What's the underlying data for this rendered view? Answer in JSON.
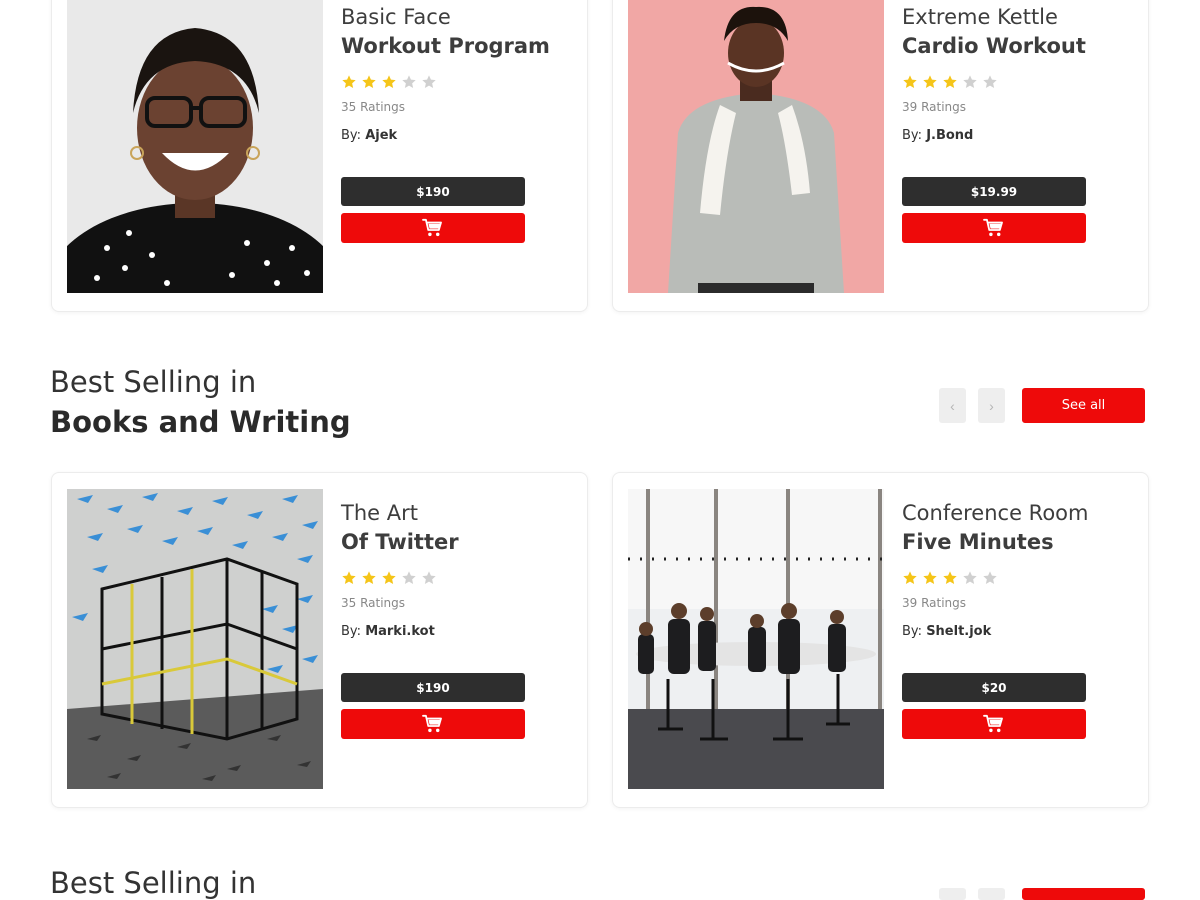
{
  "colors": {
    "accent": "#ee0a0a",
    "price_bg": "#2e2e2e",
    "star_filled": "#f5c518",
    "star_empty": "#d0d0d0"
  },
  "top_products": [
    {
      "title_line1": "Basic Face",
      "title_line2": "Workout Program",
      "rating": 3,
      "max_rating": 5,
      "ratings_count": "35 Ratings",
      "by_label": "By:",
      "author": "Ajek",
      "price": "$190",
      "image": "woman-smiling-portrait",
      "cart_icon": "cart-icon"
    },
    {
      "title_line1": "Extreme Kettle",
      "title_line2": "Cardio Workout",
      "rating": 3,
      "max_rating": 5,
      "ratings_count": "39 Ratings",
      "by_label": "By:",
      "author": "J.Bond",
      "price": "$19.99",
      "image": "man-with-towel-portrait",
      "cart_icon": "cart-icon"
    }
  ],
  "books_section": {
    "subtitle": "Best Selling in",
    "title": "Books and Writing",
    "prev_icon": "chevron-left-icon",
    "next_icon": "chevron-right-icon",
    "prev_glyph": "‹",
    "next_glyph": "›",
    "see_all_label": "See all",
    "products": [
      {
        "title_line1": "The Art",
        "title_line2": "Of Twitter",
        "rating": 3,
        "max_rating": 5,
        "ratings_count": "35 Ratings",
        "by_label": "By:",
        "author": "Marki.kot",
        "price": "$190",
        "image": "birds-cage-illustration",
        "cart_icon": "cart-icon"
      },
      {
        "title_line1": "Conference Room",
        "title_line2": "Five Minutes",
        "rating": 3,
        "max_rating": 5,
        "ratings_count": "39 Ratings",
        "by_label": "By:",
        "author": "Shelt.jok",
        "price": "$20",
        "image": "conference-room-photo",
        "cart_icon": "cart-icon"
      }
    ]
  },
  "next_section": {
    "subtitle": "Best Selling in"
  }
}
